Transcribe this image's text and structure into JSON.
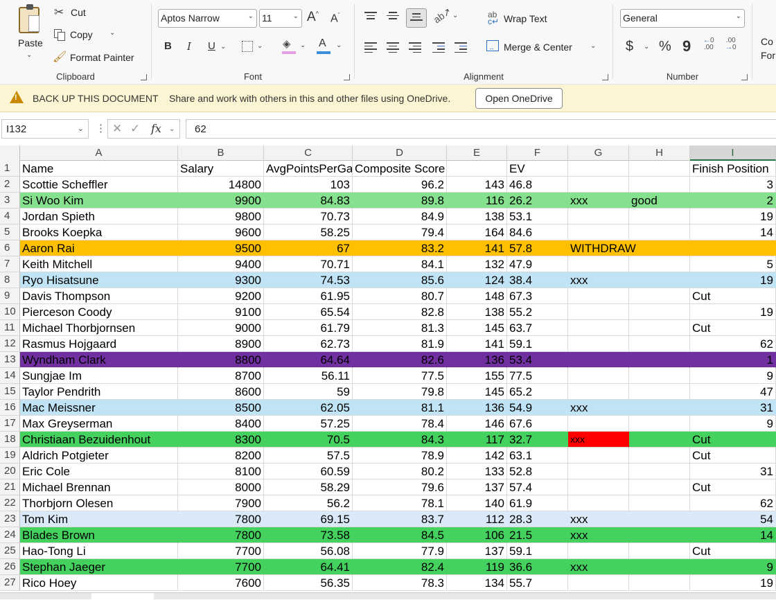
{
  "ribbon": {
    "clipboard": {
      "paste": "Paste",
      "cut": "Cut",
      "copy": "Copy",
      "format_painter": "Format Painter",
      "label": "Clipboard"
    },
    "font": {
      "font_name": "Aptos Narrow",
      "font_size": "11",
      "grow": "A",
      "shrink": "A",
      "bold": "B",
      "italic": "I",
      "underline": "U",
      "label": "Font",
      "fill_color": "#ffff00",
      "font_color": "#ff0000"
    },
    "alignment": {
      "wrap_text": "Wrap Text",
      "merge_center": "Merge & Center",
      "label": "Alignment"
    },
    "number": {
      "format": "General",
      "currency": "$",
      "percent": "%",
      "comma": "9",
      "inc_decimal": ".00",
      "dec_decimal": ".00",
      "label": "Number"
    },
    "cut_off_text": {
      "line1": "Co",
      "line2": "For"
    }
  },
  "message_bar": {
    "title": "BACK UP THIS DOCUMENT",
    "text": "Share and work with others in this and other files using OneDrive.",
    "button": "Open OneDrive"
  },
  "formula_bar": {
    "name_box": "I132",
    "fx": "fx",
    "formula": "62"
  },
  "columns": [
    "A",
    "B",
    "C",
    "D",
    "E",
    "F",
    "G",
    "H",
    "I"
  ],
  "selected_column": "I",
  "rows": [
    {
      "n": "1",
      "fill": "",
      "a": "Name",
      "b": "Salary",
      "c": "AvgPointsPerGame",
      "d": "Composite Score",
      "e": "",
      "f": "EV",
      "g": "",
      "h": "",
      "i": "Finish Position",
      "header": true
    },
    {
      "n": "2",
      "fill": "",
      "a": "Scottie Scheffler",
      "b": "14800",
      "c": "103",
      "d": "96.2",
      "e": "143",
      "f": "46.8",
      "g": "",
      "h": "",
      "i": "3"
    },
    {
      "n": "3",
      "fill": "#85e18d",
      "a": "Si Woo Kim",
      "b": "9900",
      "c": "84.83",
      "d": "89.8",
      "e": "116",
      "f": "26.2",
      "g": "xxx",
      "h": "good",
      "i": "2"
    },
    {
      "n": "4",
      "fill": "",
      "a": "Jordan Spieth",
      "b": "9800",
      "c": "70.73",
      "d": "84.9",
      "e": "138",
      "f": "53.1",
      "g": "",
      "h": "",
      "i": "19"
    },
    {
      "n": "5",
      "fill": "",
      "a": "Brooks Koepka",
      "b": "9600",
      "c": "58.25",
      "d": "79.4",
      "e": "164",
      "f": "84.6",
      "g": "",
      "h": "",
      "i": "14"
    },
    {
      "n": "6",
      "fill": "#ffc000",
      "a": "Aaron Rai",
      "b": "9500",
      "c": "67",
      "d": "83.2",
      "e": "141",
      "f": "57.8",
      "g": "WITHDRAW",
      "h": "",
      "i": ""
    },
    {
      "n": "7",
      "fill": "",
      "a": "Keith Mitchell",
      "b": "9400",
      "c": "70.71",
      "d": "84.1",
      "e": "132",
      "f": "47.9",
      "g": "",
      "h": "",
      "i": "5"
    },
    {
      "n": "8",
      "fill": "#c0e4f5",
      "a": "Ryo Hisatsune",
      "b": "9300",
      "c": "74.53",
      "d": "85.6",
      "e": "124",
      "f": "38.4",
      "g": "xxx",
      "h": "",
      "i": "19"
    },
    {
      "n": "9",
      "fill": "",
      "a": "Davis Thompson",
      "b": "9200",
      "c": "61.95",
      "d": "80.7",
      "e": "148",
      "f": "67.3",
      "g": "",
      "h": "",
      "i": "Cut"
    },
    {
      "n": "10",
      "fill": "",
      "a": "Pierceson Coody",
      "b": "9100",
      "c": "65.54",
      "d": "82.8",
      "e": "138",
      "f": "55.2",
      "g": "",
      "h": "",
      "i": "19"
    },
    {
      "n": "11",
      "fill": "",
      "a": "Michael Thorbjornsen",
      "b": "9000",
      "c": "61.79",
      "d": "81.3",
      "e": "145",
      "f": "63.7",
      "g": "",
      "h": "",
      "i": "Cut"
    },
    {
      "n": "12",
      "fill": "",
      "a": "Rasmus Hojgaard",
      "b": "8900",
      "c": "62.73",
      "d": "81.9",
      "e": "141",
      "f": "59.1",
      "g": "",
      "h": "",
      "i": "62"
    },
    {
      "n": "13",
      "fill": "#7030a0",
      "a": "Wyndham Clark",
      "b": "8800",
      "c": "64.64",
      "d": "82.6",
      "e": "136",
      "f": "53.4",
      "g": "",
      "h": "",
      "i": "1"
    },
    {
      "n": "14",
      "fill": "",
      "a": "Sungjae Im",
      "b": "8700",
      "c": "56.11",
      "d": "77.5",
      "e": "155",
      "f": "77.5",
      "g": "",
      "h": "",
      "i": "9"
    },
    {
      "n": "15",
      "fill": "",
      "a": "Taylor Pendrith",
      "b": "8600",
      "c": "59",
      "d": "79.8",
      "e": "145",
      "f": "65.2",
      "g": "",
      "h": "",
      "i": "47"
    },
    {
      "n": "16",
      "fill": "#c0e4f5",
      "a": "Mac Meissner",
      "b": "8500",
      "c": "62.05",
      "d": "81.1",
      "e": "136",
      "f": "54.9",
      "g": "xxx",
      "h": "",
      "i": "31"
    },
    {
      "n": "17",
      "fill": "",
      "a": "Max Greyserman",
      "b": "8400",
      "c": "57.25",
      "d": "78.4",
      "e": "146",
      "f": "67.6",
      "g": "",
      "h": "",
      "i": "9"
    },
    {
      "n": "18",
      "fill": "#44d15e",
      "a": "Christiaan Bezuidenhout",
      "b": "8300",
      "c": "70.5",
      "d": "84.3",
      "e": "117",
      "f": "32.7",
      "g": "xxx",
      "h": "",
      "i": "Cut",
      "g_fill": "#ff0000"
    },
    {
      "n": "19",
      "fill": "",
      "a": "Aldrich Potgieter",
      "b": "8200",
      "c": "57.5",
      "d": "78.9",
      "e": "142",
      "f": "63.1",
      "g": "",
      "h": "",
      "i": "Cut"
    },
    {
      "n": "20",
      "fill": "",
      "a": "Eric Cole",
      "b": "8100",
      "c": "60.59",
      "d": "80.2",
      "e": "133",
      "f": "52.8",
      "g": "",
      "h": "",
      "i": "31"
    },
    {
      "n": "21",
      "fill": "",
      "a": "Michael Brennan",
      "b": "8000",
      "c": "58.29",
      "d": "79.6",
      "e": "137",
      "f": "57.4",
      "g": "",
      "h": "",
      "i": "Cut"
    },
    {
      "n": "22",
      "fill": "",
      "a": "Thorbjorn Olesen",
      "b": "7900",
      "c": "56.2",
      "d": "78.1",
      "e": "140",
      "f": "61.9",
      "g": "",
      "h": "",
      "i": "62"
    },
    {
      "n": "23",
      "fill": "#dae9f8",
      "a": "Tom Kim",
      "b": "7800",
      "c": "69.15",
      "d": "83.7",
      "e": "112",
      "f": "28.3",
      "g": "xxx",
      "h": "",
      "i": "54"
    },
    {
      "n": "24",
      "fill": "#44d15e",
      "a": "Blades Brown",
      "b": "7800",
      "c": "73.58",
      "d": "84.5",
      "e": "106",
      "f": "21.5",
      "g": "xxx",
      "h": "",
      "i": "14"
    },
    {
      "n": "25",
      "fill": "",
      "a": "Hao-Tong Li",
      "b": "7700",
      "c": "56.08",
      "d": "77.9",
      "e": "137",
      "f": "59.1",
      "g": "",
      "h": "",
      "i": "Cut"
    },
    {
      "n": "26",
      "fill": "#44d15e",
      "a": "Stephan Jaeger",
      "b": "7700",
      "c": "64.41",
      "d": "82.4",
      "e": "119",
      "f": "36.6",
      "g": "xxx",
      "h": "",
      "i": "9"
    },
    {
      "n": "27",
      "fill": "",
      "a": "Rico Hoey",
      "b": "7600",
      "c": "56.35",
      "d": "78.3",
      "e": "134",
      "f": "55.7",
      "g": "",
      "h": "",
      "i": "19"
    }
  ]
}
